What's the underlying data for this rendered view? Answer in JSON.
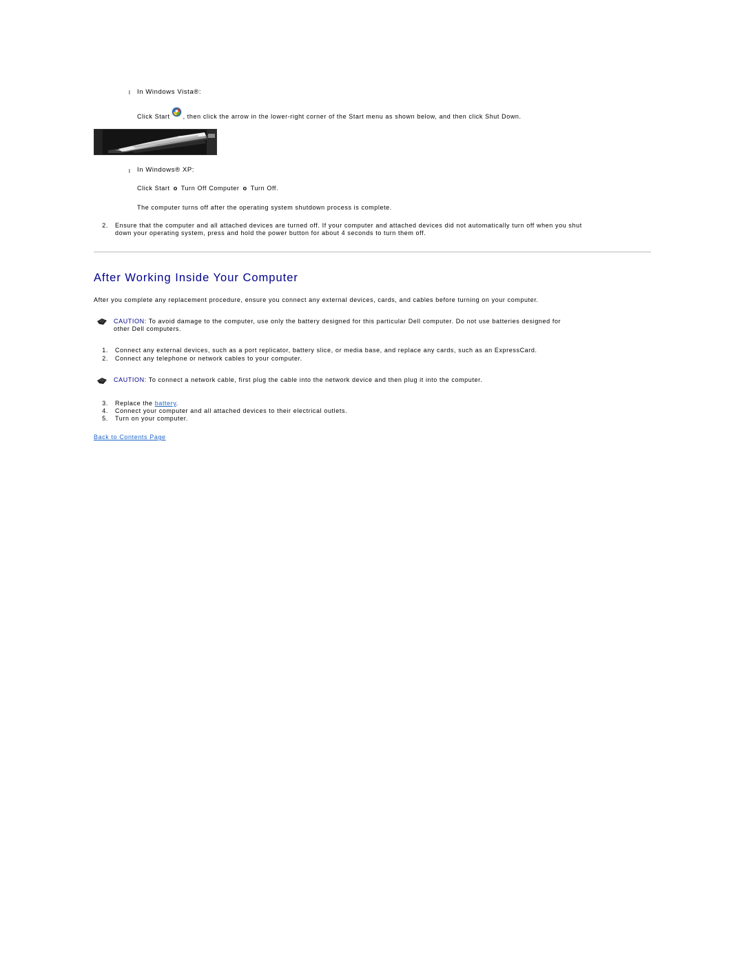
{
  "vista": {
    "bullet": "l",
    "label": "In Windows Vista®:",
    "instruction_before": "Click Start",
    "start_icon": "windows-vista-start-orb-icon",
    "instruction_after": ", then click the arrow in the lower-right corner of the Start menu as shown below, and then click Shut Down."
  },
  "xp": {
    "bullet": "l",
    "label": "In Windows® XP:",
    "step_start": "Click Start",
    "arrow_glyph": "o",
    "step_turn_off_computer": "Turn Off Computer",
    "step_turn_off": "Turn Off.",
    "note": "The computer turns off after the operating system shutdown process is complete."
  },
  "step2_before": {
    "number": "2.",
    "line1": "Ensure that the computer and all attached devices are turned off. If your computer and attached devices did not automatically turn off when you shut",
    "line2": "down your operating system, press and hold the power button for about 4 seconds to turn them off."
  },
  "section": {
    "title": "After Working Inside Your Computer",
    "intro": "After you complete any replacement procedure, ensure you connect any external devices, cards, and cables before turning on your computer."
  },
  "caution1": {
    "icon": "caution-hand-icon",
    "label": "CAUTION:",
    "line1": " To avoid damage to the computer, use only the battery designed for this particular Dell computer. Do not use batteries designed for",
    "line2": "other Dell computers."
  },
  "steps_a": [
    {
      "number": "1.",
      "text": "Connect any external devices, such as a port replicator, battery slice, or media base, and replace any cards, such as an ExpressCard."
    },
    {
      "number": "2.",
      "text": "Connect any telephone or network cables to your computer."
    }
  ],
  "caution2": {
    "icon": "caution-hand-icon",
    "label": "CAUTION:",
    "text": " To connect a network cable, first plug the cable into the network device and then plug it into the computer."
  },
  "steps_b": {
    "step3": {
      "number": "3.",
      "before": "Replace the ",
      "link": "battery",
      "after": "."
    },
    "step4": {
      "number": "4.",
      "text": "Connect your computer and all attached devices to their electrical outlets."
    },
    "step5": {
      "number": "5.",
      "text": "Turn on your computer."
    }
  },
  "footer": {
    "back_link": "Back to Contents Page"
  },
  "colors": {
    "heading": "#00008b",
    "link": "#2066c8",
    "caution_label": "#00008b",
    "rule": "#b8b8b8"
  }
}
